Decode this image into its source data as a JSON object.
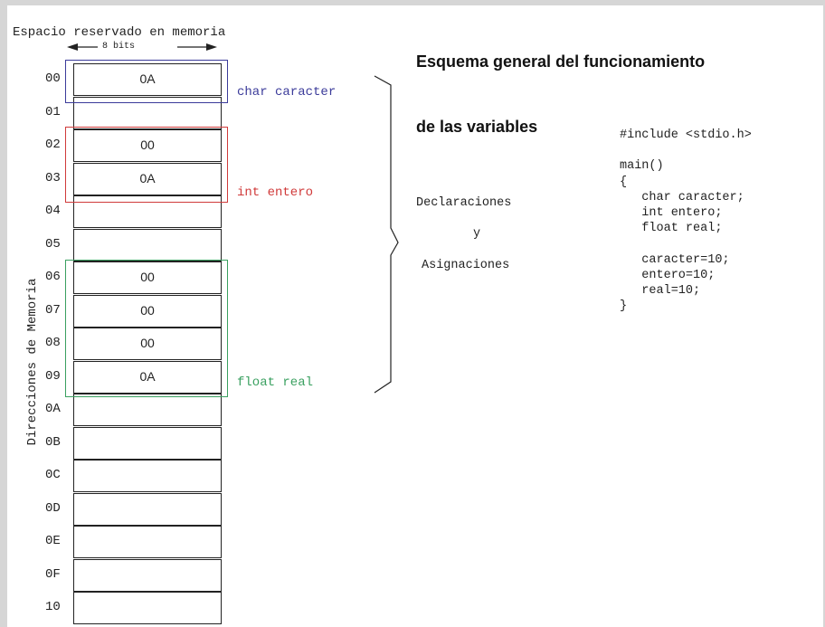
{
  "title": [
    "Esquema general del funcionamiento",
    "de las variables"
  ],
  "memory": {
    "space_label": "Espacio reservado en memoria",
    "bits_label": "8 bits",
    "axis_label": "Direcciones de Memoria",
    "addresses": [
      "00",
      "01",
      "02",
      "03",
      "04",
      "05",
      "06",
      "07",
      "08",
      "09",
      "0A",
      "0B",
      "0C",
      "0D",
      "0E",
      "0F",
      "10"
    ],
    "values": [
      "0A",
      "",
      "00",
      "0A",
      "",
      "",
      "00",
      "00",
      "00",
      "0A",
      "",
      "",
      "",
      "",
      "",
      "",
      ""
    ]
  },
  "variables": [
    {
      "label": "char caracter",
      "color": "#3b3b9a"
    },
    {
      "label": "int entero",
      "color": "#d03a3a"
    },
    {
      "label": "float real",
      "color": "#3aa060"
    }
  ],
  "middle": {
    "declaraciones": "Declaraciones",
    "y": "y",
    "asignaciones": "Asignaciones"
  },
  "code": [
    "#include <stdio.h>",
    "",
    "main()",
    "{",
    "   char caracter;",
    "   int entero;",
    "   float real;",
    "",
    "   caracter=10;",
    "   entero=10;",
    "   real=10;",
    "}"
  ]
}
